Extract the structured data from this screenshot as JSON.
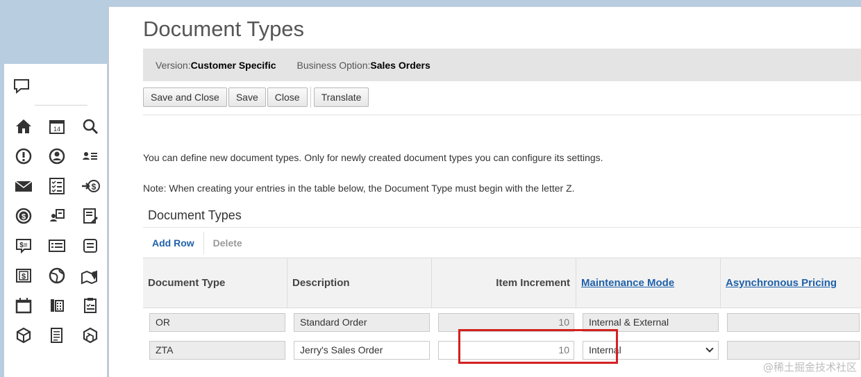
{
  "page_title": "Document Types",
  "infobar": {
    "version_label": "Version:",
    "version_value": "Customer Specific",
    "business_option_label": "Business Option:",
    "business_option_value": "Sales Orders"
  },
  "toolbar": {
    "save_and_close": "Save and Close",
    "save": "Save",
    "close": "Close",
    "translate": "Translate"
  },
  "description_line1": "You can define new document types. Only for newly created document types you can configure its settings.",
  "description_line2": "Note: When creating your entries in the table below, the Document Type must begin with the letter Z.",
  "section_title": "Document Types",
  "actions": {
    "add_row": "Add Row",
    "delete": "Delete"
  },
  "table": {
    "columns": [
      "Document Type",
      "Description",
      "Item Increment",
      "Maintenance Mode",
      "Asynchronous Pricing"
    ],
    "rows": [
      {
        "document_type": "OR",
        "description": "Standard Order",
        "item_increment": "10",
        "maintenance_mode": "Internal & External",
        "asynchronous_pricing": ""
      },
      {
        "document_type": "ZTA",
        "description": "Jerry's Sales Order",
        "item_increment": "10",
        "maintenance_mode": "Internal",
        "asynchronous_pricing": ""
      }
    ]
  },
  "watermark": "@稀土掘金技术社区",
  "colors": {
    "link": "#1f61a9",
    "highlight": "#d42020",
    "background": "#b9cde0"
  },
  "sidebar_icons": [
    "home-icon",
    "calendar-icon",
    "search-icon",
    "alert-icon",
    "user-circle-icon",
    "user-list-icon",
    "mail-icon",
    "checklist-icon",
    "money-transfer-icon",
    "dollar-coin-icon",
    "person-card-icon",
    "edit-doc-icon",
    "price-tag-icon",
    "list-card-icon",
    "bracket-list-icon",
    "dollar-doc-icon",
    "globe-dollar-icon",
    "map-pin-icon",
    "calendar-blank-icon",
    "phone-book-icon",
    "clipboard-icon",
    "cube-icon",
    "document-list-icon",
    "box-icon"
  ]
}
